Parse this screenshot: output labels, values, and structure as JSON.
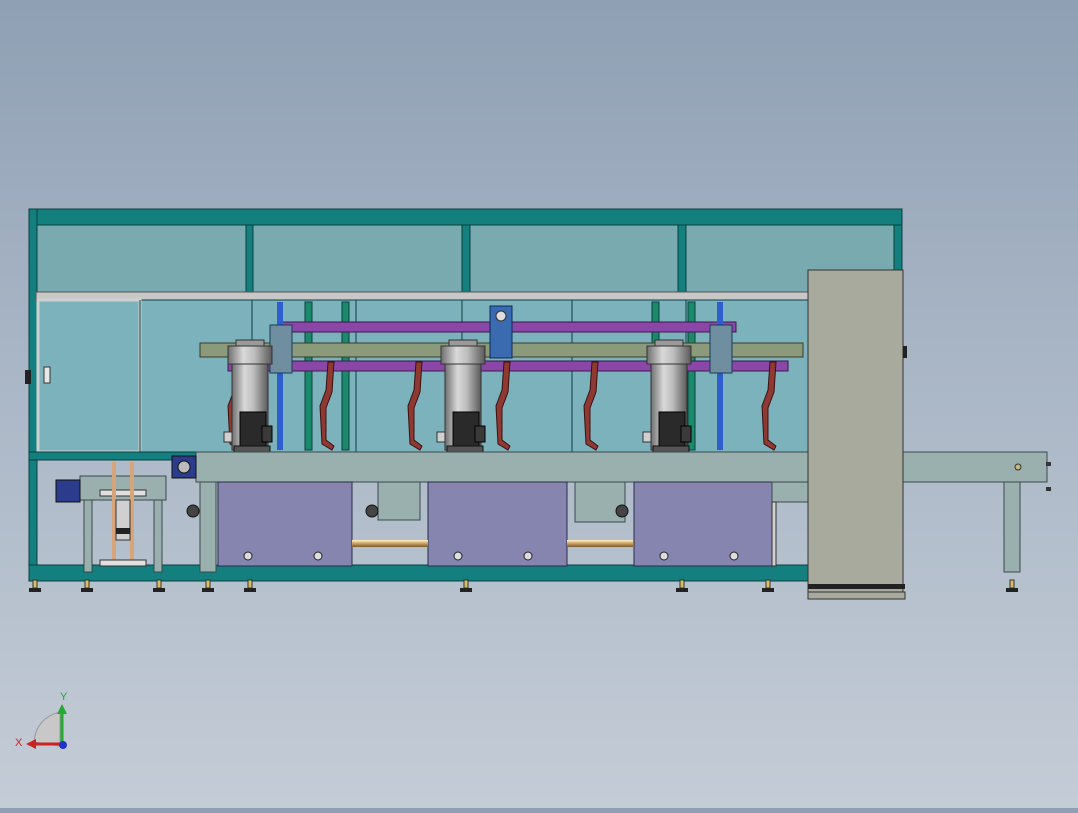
{
  "viewport": {
    "title": "",
    "background_top": "#8fa0b4",
    "background_bottom": "#c4ccd6"
  },
  "model": {
    "frame_color": "#137f7f",
    "glass_color": "#78aab0",
    "purple_rail_color": "#8a47a8",
    "blue_rod_color": "#2d5fcf",
    "hook_color": "#8e3a32",
    "tank_color": "#8585b0",
    "cabinet_color": "#a9aa9e",
    "conveyor_color": "#9ab0ae",
    "heater_count": 3,
    "hook_count": 6,
    "tank_count": 3
  },
  "triad": {
    "x_label": "X",
    "y_label": "Y",
    "x_color": "#cc2222",
    "y_color": "#22aa33",
    "z_color": "#2233cc"
  }
}
